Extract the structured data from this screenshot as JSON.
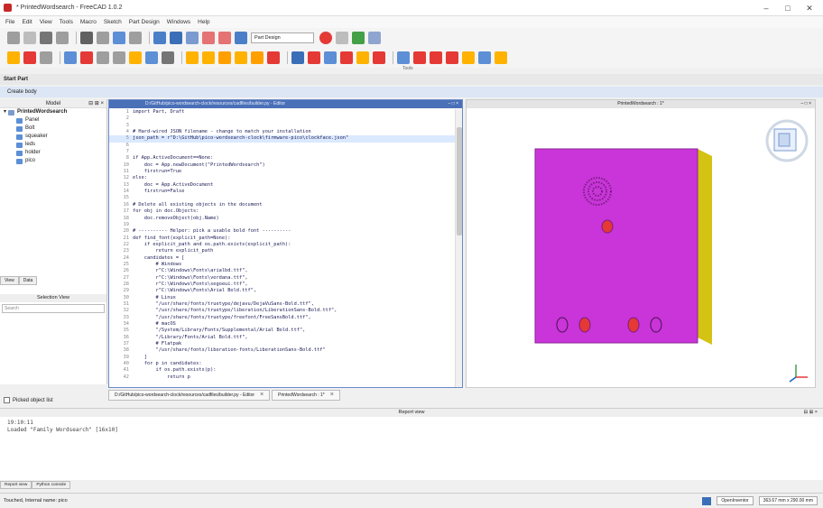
{
  "window": {
    "title": "* PrintedWordsearch - FreeCAD 1.0.2",
    "controls": [
      "–",
      "□",
      "✕"
    ]
  },
  "menu": [
    "File",
    "Edit",
    "View",
    "Tools",
    "Macro",
    "Sketch",
    "Part Design",
    "Windows",
    "Help"
  ],
  "toolbar": {
    "workbench_combo": "Part Design",
    "tools_label": "Tools"
  },
  "start_part_label": "Start Part",
  "create_body_label": "Create body",
  "model": {
    "header": "Model",
    "root": "PrintedWordsearch",
    "items": [
      "Panel",
      "Bolt",
      "squeaker",
      "leds",
      "holder",
      "pico"
    ]
  },
  "left_tabs": [
    "View",
    "Data"
  ],
  "selection_view": {
    "header": "Selection View",
    "search_placeholder": "Search"
  },
  "picked_label": "Picked object list",
  "editor": {
    "title": "D:/GitHub/pico-wordsearch-clock/resources/cadfiles/builder.py - Editor",
    "lines": [
      {
        "n": "1",
        "t": "import Part, Draft"
      },
      {
        "n": "2",
        "t": ""
      },
      {
        "n": "3",
        "t": ""
      },
      {
        "n": "4",
        "t": "# Hard-wired JSON filename - change to match your installation"
      },
      {
        "n": "5",
        "t": "json_path = r\"D:\\GitHub\\pico-wordsearch-clock\\firmware-pico\\clockface.json\""
      },
      {
        "n": "6",
        "t": ""
      },
      {
        "n": "7",
        "t": ""
      },
      {
        "n": "8",
        "t": "if App.ActiveDocument==None:"
      },
      {
        "n": "10",
        "t": "    doc = App.newDocument(\"PrintedWordsearch\")"
      },
      {
        "n": "11",
        "t": "    firstrun=True"
      },
      {
        "n": "12",
        "t": "else:"
      },
      {
        "n": "13",
        "t": "    doc = App.ActiveDocument"
      },
      {
        "n": "14",
        "t": "    firstrun=False"
      },
      {
        "n": "15",
        "t": ""
      },
      {
        "n": "16",
        "t": "# Delete all existing objects in the document"
      },
      {
        "n": "17",
        "t": "for obj in doc.Objects:"
      },
      {
        "n": "18",
        "t": "    doc.removeObject(obj.Name)"
      },
      {
        "n": "19",
        "t": ""
      },
      {
        "n": "20",
        "t": "# ---------- Helper: pick a usable bold font ----------"
      },
      {
        "n": "21",
        "t": "def find_font(explicit_path=None):"
      },
      {
        "n": "22",
        "t": "    if explicit_path and os.path.exists(explicit_path):"
      },
      {
        "n": "23",
        "t": "        return explicit_path"
      },
      {
        "n": "24",
        "t": "    candidates = ["
      },
      {
        "n": "25",
        "t": "        # Windows"
      },
      {
        "n": "26",
        "t": "        r\"C:\\Windows\\Fonts\\arialbd.ttf\","
      },
      {
        "n": "27",
        "t": "        r\"C:\\Windows\\Fonts\\verdana.ttf\","
      },
      {
        "n": "28",
        "t": "        r\"C:\\Windows\\Fonts\\segoeui.ttf\","
      },
      {
        "n": "29",
        "t": "        r\"C:\\Windows\\Fonts\\Arial Bold.ttf\","
      },
      {
        "n": "30",
        "t": "        # Linux"
      },
      {
        "n": "31",
        "t": "        \"/usr/share/fonts/truetype/dejavu/DejaVuSans-Bold.ttf\","
      },
      {
        "n": "32",
        "t": "        \"/usr/share/fonts/truetype/liberation/LiberationSans-Bold.ttf\","
      },
      {
        "n": "33",
        "t": "        \"/usr/share/fonts/truetype/freefont/FreeSansBold.ttf\","
      },
      {
        "n": "34",
        "t": "        # macOS"
      },
      {
        "n": "35",
        "t": "        \"/System/Library/Fonts/Supplemental/Arial Bold.ttf\","
      },
      {
        "n": "36",
        "t": "        \"/Library/Fonts/Arial Bold.ttf\","
      },
      {
        "n": "37",
        "t": "        # Flatpak"
      },
      {
        "n": "38",
        "t": "        \"/usr/share/fonts/liberation-fonts/LiberationSans-Bold.ttf\""
      },
      {
        "n": "39",
        "t": "    ]"
      },
      {
        "n": "40",
        "t": "    for p in candidates:"
      },
      {
        "n": "41",
        "t": "        if os.path.exists(p):"
      },
      {
        "n": "42",
        "t": "            return p"
      }
    ],
    "highlight_line": 4
  },
  "view3d": {
    "title": "PrintedWordsearch : 1*"
  },
  "doc_tabs": [
    "D:/GitHub/pico-wordsearch-clock/resources/cadfiles/builder.py - Editor",
    "PrintedWordsearch : 1*"
  ],
  "report": {
    "title": "Report view",
    "lines": [
      "19:10:11",
      "Loaded \"Family Wordsearch\" [16x10]"
    ]
  },
  "bottom_tabs": [
    "Report view",
    "Python console"
  ],
  "status": {
    "left": "Touched, Internal name: pico",
    "navigation": "OpenInventor",
    "dimensions": "363.67 mm x 290.00 mm"
  },
  "colors": {
    "panel_face": "#c935d8",
    "panel_edge": "#d4c312",
    "code_keyword": "#0000c0",
    "editor_accent": "#4a70b8"
  }
}
